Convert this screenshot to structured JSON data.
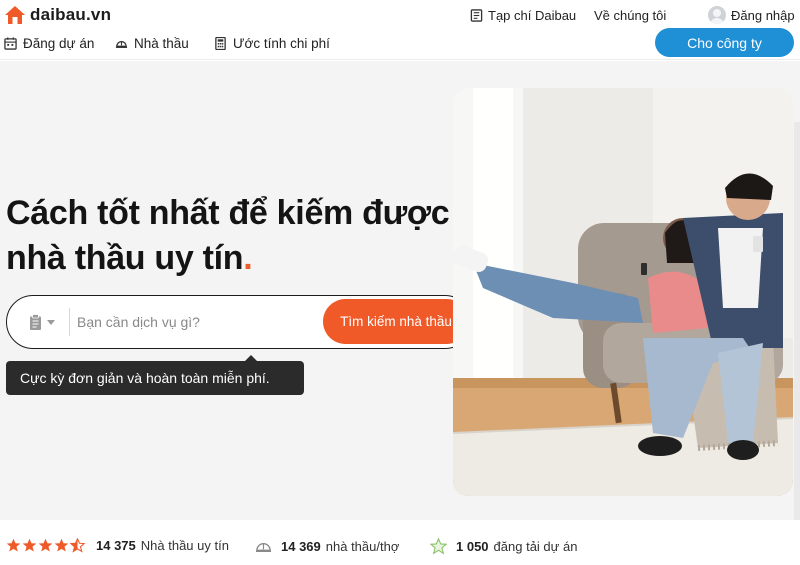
{
  "brand": {
    "name": "daibau.vn",
    "color": "#f05a28"
  },
  "header": {
    "links": [
      {
        "label": "Tạp chí Daibau",
        "icon": "magazine-icon"
      },
      {
        "label": "Về chúng tôi"
      },
      {
        "label": "Đăng nhập",
        "icon": "user-avatar-icon"
      }
    ],
    "nav": [
      {
        "label": "Đăng dự án",
        "icon": "calendar-icon"
      },
      {
        "label": "Nhà thầu",
        "icon": "helmet-icon"
      },
      {
        "label": "Ước tính chi phí",
        "icon": "calculator-icon"
      }
    ],
    "cta_label": "Cho công ty",
    "cta_color": "#1f8fd6"
  },
  "hero": {
    "title_line1": "Cách tốt nhất để kiếm được",
    "title_line2": "nhà thầu uy tín",
    "title_dot": ".",
    "search": {
      "category_icon": "clipboard-icon",
      "placeholder": "Bạn cần dịch vụ gì?",
      "value": "",
      "button_label": "Tìm kiếm nhà thầu"
    },
    "tooltip": "Cực kỳ đơn giản và hoàn toàn miễn phí."
  },
  "stats": {
    "rating": {
      "value": 4.5,
      "max": 5
    },
    "items": [
      {
        "number": "14 375",
        "label": "Nhà thầu uy tín"
      },
      {
        "number": "14 369",
        "label": "nhà thầu/thợ",
        "icon": "helmet-icon"
      },
      {
        "number": "1 050",
        "label": "đăng tải dự án",
        "icon": "star-outline-icon"
      }
    ]
  }
}
